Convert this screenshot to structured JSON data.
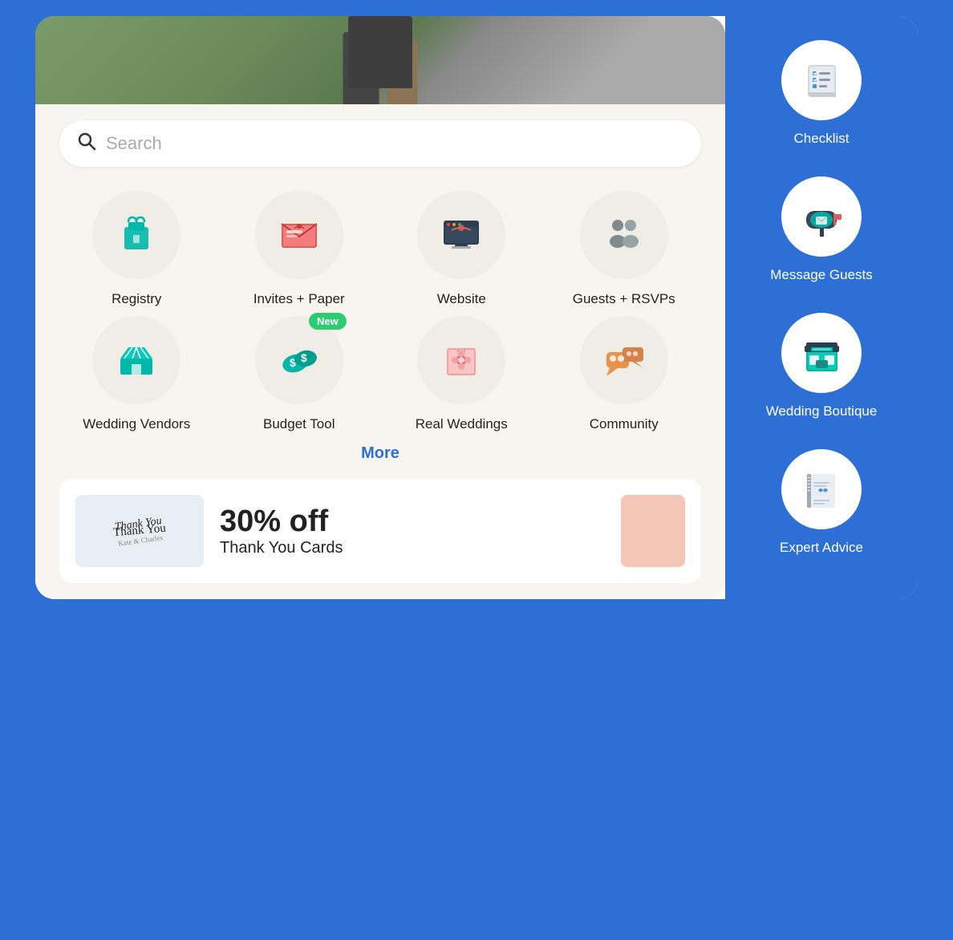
{
  "search": {
    "placeholder": "Search"
  },
  "grid": {
    "items": [
      {
        "id": "registry",
        "label": "Registry",
        "icon": "gift",
        "new": false
      },
      {
        "id": "invites-paper",
        "label": "Invites + Paper",
        "icon": "envelope",
        "new": false
      },
      {
        "id": "website",
        "label": "Website",
        "icon": "monitor",
        "new": false
      },
      {
        "id": "guests-rsvps",
        "label": "Guests + RSVPs",
        "icon": "guests",
        "new": false
      },
      {
        "id": "wedding-vendors",
        "label": "Wedding Vendors",
        "icon": "tent",
        "new": false
      },
      {
        "id": "budget-tool",
        "label": "Budget Tool",
        "icon": "money",
        "new": true
      },
      {
        "id": "real-weddings",
        "label": "Real Weddings",
        "icon": "flower",
        "new": false
      },
      {
        "id": "community",
        "label": "Community",
        "icon": "chat",
        "new": false
      }
    ],
    "new_badge_label": "New",
    "more_label": "More"
  },
  "promo": {
    "discount": "30% off",
    "subtitle": "Thank You Cards"
  },
  "sidebar": {
    "items": [
      {
        "id": "checklist",
        "label": "Checklist",
        "icon": "checklist"
      },
      {
        "id": "message-guests",
        "label": "Message Guests",
        "icon": "mailbox"
      },
      {
        "id": "wedding-boutique",
        "label": "Wedding Boutique",
        "icon": "storefront"
      },
      {
        "id": "expert-advice",
        "label": "Expert Advice",
        "icon": "notebook"
      }
    ]
  }
}
